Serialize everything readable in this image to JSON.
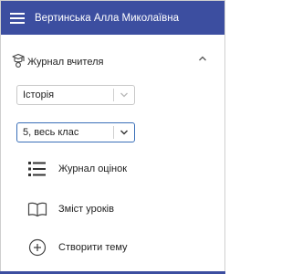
{
  "header": {
    "user_name": "Вертинська Алла Миколаївна",
    "menu_icon": "hamburger-menu-icon",
    "background_color": "#3c4ea0"
  },
  "section": {
    "title": "Журнал вчителя",
    "icon": "teacher-journal-icon",
    "expanded": true,
    "toggle_icon": "chevron-up-icon"
  },
  "subject_select": {
    "value": "Історія",
    "icon": "chevron-down-icon"
  },
  "class_select": {
    "value": "5, весь клас",
    "icon": "chevron-down-icon",
    "accent_color": "#3a6fb8"
  },
  "nav": {
    "journal": {
      "label": "Журнал оцінок",
      "icon": "list-icon"
    },
    "lessons": {
      "label": "Зміст уроків",
      "icon": "book-icon"
    },
    "create": {
      "label": "Створити тему",
      "icon": "plus-circle-icon"
    }
  }
}
